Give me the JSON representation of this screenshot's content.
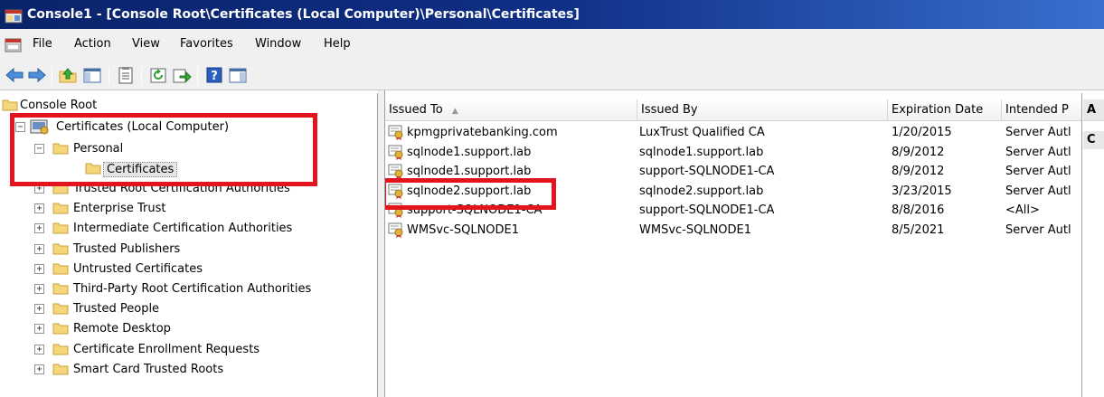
{
  "window": {
    "title": "Console1 - [Console Root\\Certificates (Local Computer)\\Personal\\Certificates]"
  },
  "menu": [
    "File",
    "Action",
    "View",
    "Favorites",
    "Window",
    "Help"
  ],
  "toolbar": [
    "back-arrow-icon",
    "forward-arrow-icon",
    "up-folder-icon",
    "show-hide-tree-icon",
    "properties-icon",
    "refresh-icon",
    "export-list-icon",
    "help-icon",
    "show-hide-action-pane-icon"
  ],
  "tree": {
    "root": "Console Root",
    "certificates": "Certificates (Local Computer)",
    "personal": "Personal",
    "personal_child": "Certificates",
    "stores": [
      "Trusted Root Certification Authorities",
      "Enterprise Trust",
      "Intermediate Certification Authorities",
      "Trusted Publishers",
      "Untrusted Certificates",
      "Third-Party Root Certification Authorities",
      "Trusted People",
      "Remote Desktop",
      "Certificate Enrollment Requests",
      "Smart Card Trusted Roots"
    ]
  },
  "list": {
    "columns": [
      "Issued To",
      "Issued By",
      "Expiration Date",
      "Intended P"
    ],
    "sort_indicator": "▲",
    "rows": [
      [
        "kpmgprivatebanking.com",
        "LuxTrust Qualified CA",
        "1/20/2015",
        "Server Autl"
      ],
      [
        "sqlnode1.support.lab",
        "sqlnode1.support.lab",
        "8/9/2012",
        "Server Autl"
      ],
      [
        "sqlnode1.support.lab",
        "support-SQLNODE1-CA",
        "8/9/2012",
        "Server Autl"
      ],
      [
        "sqlnode2.support.lab",
        "sqlnode2.support.lab",
        "3/23/2015",
        "Server Autl"
      ],
      [
        "support-SQLNODE1-CA",
        "support-SQLNODE1-CA",
        "8/8/2016",
        "<All>"
      ],
      [
        "WMSvc-SQLNODE1",
        "WMSvc-SQLNODE1",
        "8/5/2021",
        "Server Autl"
      ]
    ]
  },
  "actions": {
    "header": "A",
    "item": "C"
  },
  "colors": {
    "highlight_box": "#e3141e",
    "titlebar": "#0a246a",
    "folder": "#f5d67a"
  }
}
